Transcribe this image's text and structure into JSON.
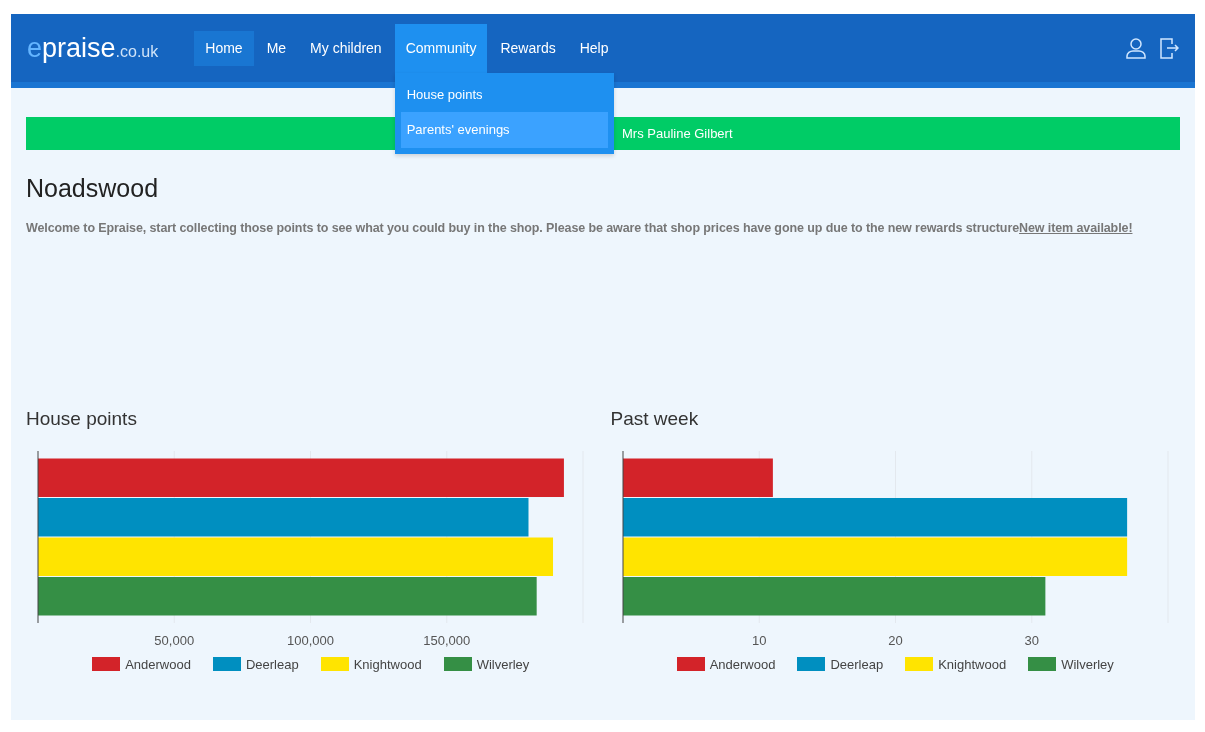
{
  "brand": {
    "main": "epraise",
    "suffix": ".co.uk"
  },
  "nav": [
    {
      "label": "Home",
      "selected": true,
      "expanded": false
    },
    {
      "label": "Me",
      "selected": false,
      "expanded": false
    },
    {
      "label": "My children",
      "selected": false,
      "expanded": false
    },
    {
      "label": "Community",
      "selected": false,
      "expanded": true,
      "menu": [
        {
          "label": "House points",
          "selected": false
        },
        {
          "label": "Parents' evenings",
          "selected": true
        }
      ]
    },
    {
      "label": "Rewards",
      "selected": false,
      "expanded": false
    },
    {
      "label": "Help",
      "selected": false,
      "expanded": false
    }
  ],
  "alert": "Mrs Pauline Gilbert",
  "heading": "Noadswood",
  "welcome": {
    "text": "Welcome to Epraise, start collecting those points to see what you could buy in the shop. Please be aware that shop prices have gone up due to the new rewards structure",
    "link": "New item available!"
  },
  "charts": [
    {
      "title": "House points",
      "chart_data": {
        "type": "bar",
        "orientation": "horizontal",
        "grid": true,
        "series": [
          {
            "name": "Anderwood",
            "color": "#d32329",
            "values": [
              193000
            ]
          },
          {
            "name": "Deerleap",
            "color": "#008fc0",
            "values": [
              180000
            ]
          },
          {
            "name": "Knightwood",
            "color": "#ffe400",
            "values": [
              189000
            ]
          },
          {
            "name": "Wilverley",
            "color": "#358f45",
            "values": [
              183000
            ]
          }
        ],
        "xlim": [
          0,
          200000
        ],
        "xticks": [
          {
            "value": 50000,
            "label": "50,000"
          },
          {
            "value": 100000,
            "label": "100,000"
          },
          {
            "value": 150000,
            "label": "150,000"
          }
        ]
      }
    },
    {
      "title": "Past week",
      "chart_data": {
        "type": "bar",
        "orientation": "horizontal",
        "grid": true,
        "series": [
          {
            "name": "Anderwood",
            "color": "#d32329",
            "values": [
              11
            ]
          },
          {
            "name": "Deerleap",
            "color": "#008fc0",
            "values": [
              37
            ]
          },
          {
            "name": "Knightwood",
            "color": "#ffe400",
            "values": [
              37
            ]
          },
          {
            "name": "Wilverley",
            "color": "#358f45",
            "values": [
              31
            ]
          }
        ],
        "xlim": [
          0,
          40
        ],
        "xticks": [
          {
            "value": 10,
            "label": "10"
          },
          {
            "value": 20,
            "label": "20"
          },
          {
            "value": 30,
            "label": "30"
          }
        ]
      }
    }
  ]
}
